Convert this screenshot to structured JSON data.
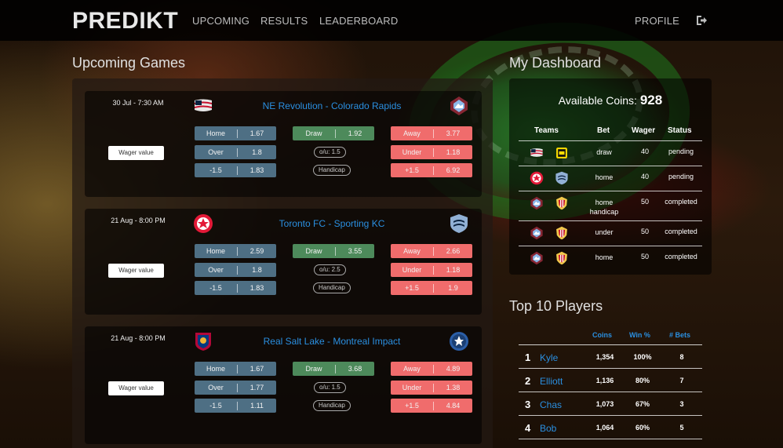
{
  "brand": "PREDIKT",
  "nav": {
    "upcoming": "UPCOMING",
    "results": "RESULTS",
    "leaderboard": "LEADERBOARD",
    "profile": "PROFILE"
  },
  "upcoming_title": "Upcoming Games",
  "dashboard_title": "My Dashboard",
  "top_title": "Top 10 Players",
  "games": [
    {
      "date": "30 Jul - 7:30 AM",
      "title": "NE Revolution - Colorado Rapids",
      "wager_label": "Wager value",
      "home_icon": "ne-revolution-logo-icon",
      "away_icon": "colorado-rapids-logo-icon",
      "row1": {
        "home_l": "Home",
        "home_v": "1.67",
        "draw_l": "Draw",
        "draw_v": "1.92",
        "away_l": "Away",
        "away_v": "3.77"
      },
      "row2": {
        "over_l": "Over",
        "over_v": "1.8",
        "ou": "o/u: 1.5",
        "under_l": "Under",
        "under_v": "1.18"
      },
      "row3": {
        "h1_l": "-1.5",
        "h1_v": "1.83",
        "hc": "Handicap",
        "h2_l": "+1.5",
        "h2_v": "6.92"
      }
    },
    {
      "date": "21 Aug - 8:00 PM",
      "title": "Toronto FC - Sporting KC",
      "wager_label": "Wager value",
      "home_icon": "toronto-fc-logo-icon",
      "away_icon": "sporting-kc-logo-icon",
      "row1": {
        "home_l": "Home",
        "home_v": "2.59",
        "draw_l": "Draw",
        "draw_v": "3.55",
        "away_l": "Away",
        "away_v": "2.66"
      },
      "row2": {
        "over_l": "Over",
        "over_v": "1.8",
        "ou": "o/u: 2.5",
        "under_l": "Under",
        "under_v": "1.18"
      },
      "row3": {
        "h1_l": "-1.5",
        "h1_v": "1.83",
        "hc": "Handicap",
        "h2_l": "+1.5",
        "h2_v": "1.9"
      }
    },
    {
      "date": "21 Aug - 8:00 PM",
      "title": "Real Salt Lake - Montreal Impact",
      "wager_label": "Wager value",
      "home_icon": "real-salt-lake-logo-icon",
      "away_icon": "montreal-impact-logo-icon",
      "row1": {
        "home_l": "Home",
        "home_v": "1.67",
        "draw_l": "Draw",
        "draw_v": "3.68",
        "away_l": "Away",
        "away_v": "4.89"
      },
      "row2": {
        "over_l": "Over",
        "over_v": "1.77",
        "ou": "o/u: 1.5",
        "under_l": "Under",
        "under_v": "1.38"
      },
      "row3": {
        "h1_l": "-1.5",
        "h1_v": "1.11",
        "hc": "Handicap",
        "h2_l": "+1.5",
        "h2_v": "4.84"
      }
    }
  ],
  "dashboard": {
    "coins_label": "Available Coins:",
    "coins_value": "928",
    "headers": {
      "teams": "Teams",
      "bet": "Bet",
      "wager": "Wager",
      "status": "Status"
    },
    "rows": [
      {
        "bet": "draw",
        "wager": "40",
        "status": "pending"
      },
      {
        "bet": "home",
        "wager": "40",
        "status": "pending"
      },
      {
        "bet": "home handicap",
        "wager": "50",
        "status": "completed"
      },
      {
        "bet": "under",
        "wager": "50",
        "status": "completed"
      },
      {
        "bet": "home",
        "wager": "50",
        "status": "completed"
      }
    ]
  },
  "top_players": {
    "headers": {
      "coins": "Coins",
      "win": "Win %",
      "bets": "# Bets"
    },
    "rows": [
      {
        "rank": "1",
        "name": "Kyle",
        "coins": "1,354",
        "win": "100%",
        "bets": "8"
      },
      {
        "rank": "2",
        "name": "Elliott",
        "coins": "1,136",
        "win": "80%",
        "bets": "7"
      },
      {
        "rank": "3",
        "name": "Chas",
        "coins": "1,073",
        "win": "67%",
        "bets": "3"
      },
      {
        "rank": "4",
        "name": "Bob",
        "coins": "1,064",
        "win": "60%",
        "bets": "5"
      }
    ]
  },
  "colors": {
    "blue_odd": "#4e6f84",
    "green_odd": "#4d8a5b",
    "red_odd": "#f06c6c",
    "link": "#2a8fe0"
  }
}
